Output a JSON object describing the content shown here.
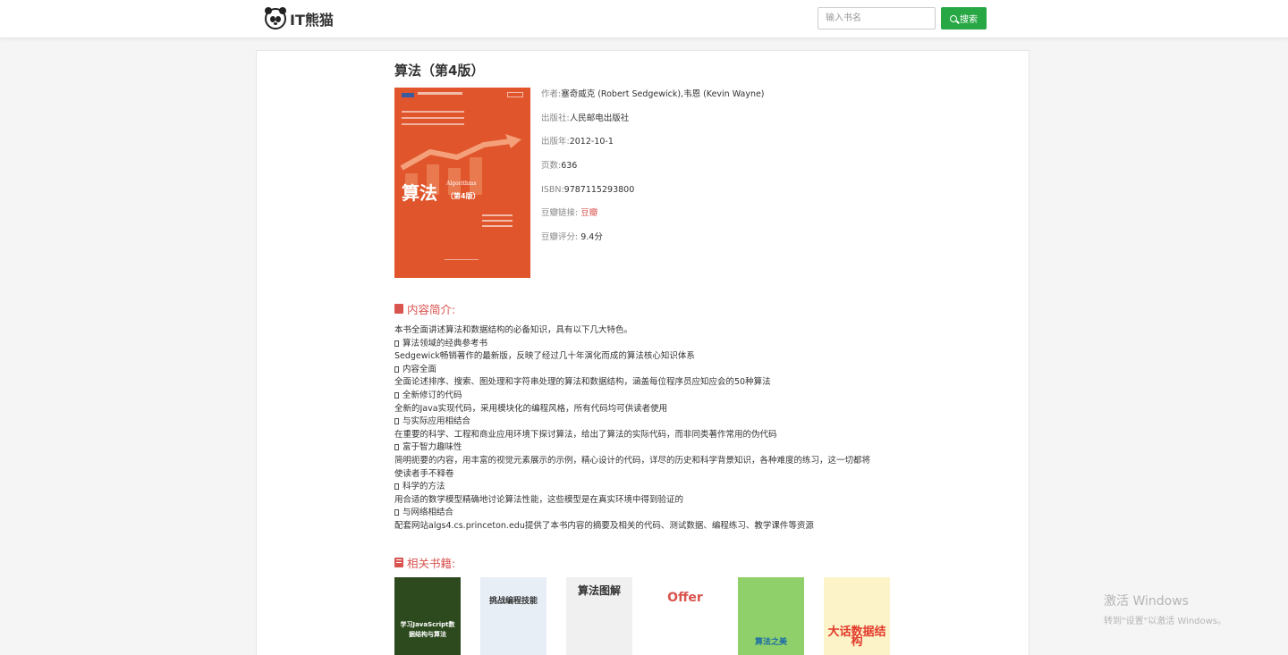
{
  "header": {
    "logo_text": "IT熊猫",
    "search_placeholder": "输入书名",
    "search_button": "搜索"
  },
  "book": {
    "title": "算法（第4版）",
    "cover": {
      "title": "算法",
      "subtitle": "Algorithms",
      "edition": "（第4版）"
    },
    "meta": [
      {
        "label": "作者:",
        "value": "塞奇威克 (Robert Sedgewick),韦恩 (Kevin Wayne)"
      },
      {
        "label": "出版社:",
        "value": "人民邮电出版社"
      },
      {
        "label": "出版年:",
        "value": "2012-10-1"
      },
      {
        "label": "页数:",
        "value": "636"
      },
      {
        "label": "ISBN:",
        "value": "9787115293800"
      },
      {
        "label": "豆瓣链接: ",
        "value": "豆瓣",
        "link": true
      },
      {
        "label": "豆瓣评分: ",
        "value": "9.4分"
      }
    ]
  },
  "intro": {
    "heading": "内容简介:",
    "lines": [
      {
        "text": "本书全面讲述算法和数据结构的必备知识，具有以下几大特色。"
      },
      {
        "text": "算法领域的经典参考书",
        "box": true
      },
      {
        "text": "Sedgewick畅销著作的最新版，反映了经过几十年演化而成的算法核心知识体系"
      },
      {
        "text": "内容全面",
        "box": true
      },
      {
        "text": "全面论述排序、搜索、图处理和字符串处理的算法和数据结构，涵盖每位程序员应知应会的50种算法"
      },
      {
        "text": "全新修订的代码",
        "box": true
      },
      {
        "text": "全新的Java实现代码，采用模块化的编程风格，所有代码均可供读者使用"
      },
      {
        "text": "与实际应用相结合",
        "box": true
      },
      {
        "text": "在重要的科学、工程和商业应用环境下探讨算法，给出了算法的实际代码，而非同类著作常用的伪代码"
      },
      {
        "text": "富于智力趣味性",
        "box": true
      },
      {
        "text": "简明扼要的内容，用丰富的视觉元素展示的示例，精心设计的代码，详尽的历史和科学背景知识，各种难度的练习，这一切都将"
      },
      {
        "text": "使读者手不释卷"
      },
      {
        "text": "科学的方法",
        "box": true
      },
      {
        "text": "用合适的数学模型精确地讨论算法性能，这些模型是在真实环境中得到验证的"
      },
      {
        "text": "与网络相结合",
        "box": true
      },
      {
        "text": "配套网站algs4.cs.princeton.edu提供了本书内容的摘要及相关的代码、测试数据、编程练习、教学课件等资源"
      }
    ]
  },
  "related": {
    "heading": "相关书籍:",
    "books": [
      {
        "cover_text": "学习JavaScript数据结构与算法",
        "bg": "#2d4a1e"
      },
      {
        "cover_text": "挑战编程技能",
        "bg": "#e8eef5"
      },
      {
        "cover_text": "算法图解",
        "bg": "#f0f0f0"
      },
      {
        "cover_text": "Offer",
        "bg": "#ffffff"
      },
      {
        "cover_text": "算法之美",
        "bg": "#8fd06a"
      },
      {
        "cover_text": "大话数据结构",
        "bg": "#fdf3c8"
      }
    ]
  },
  "watermark": {
    "line1": "激活 Windows",
    "line2": "转到\"设置\"以激活 Windows。"
  }
}
